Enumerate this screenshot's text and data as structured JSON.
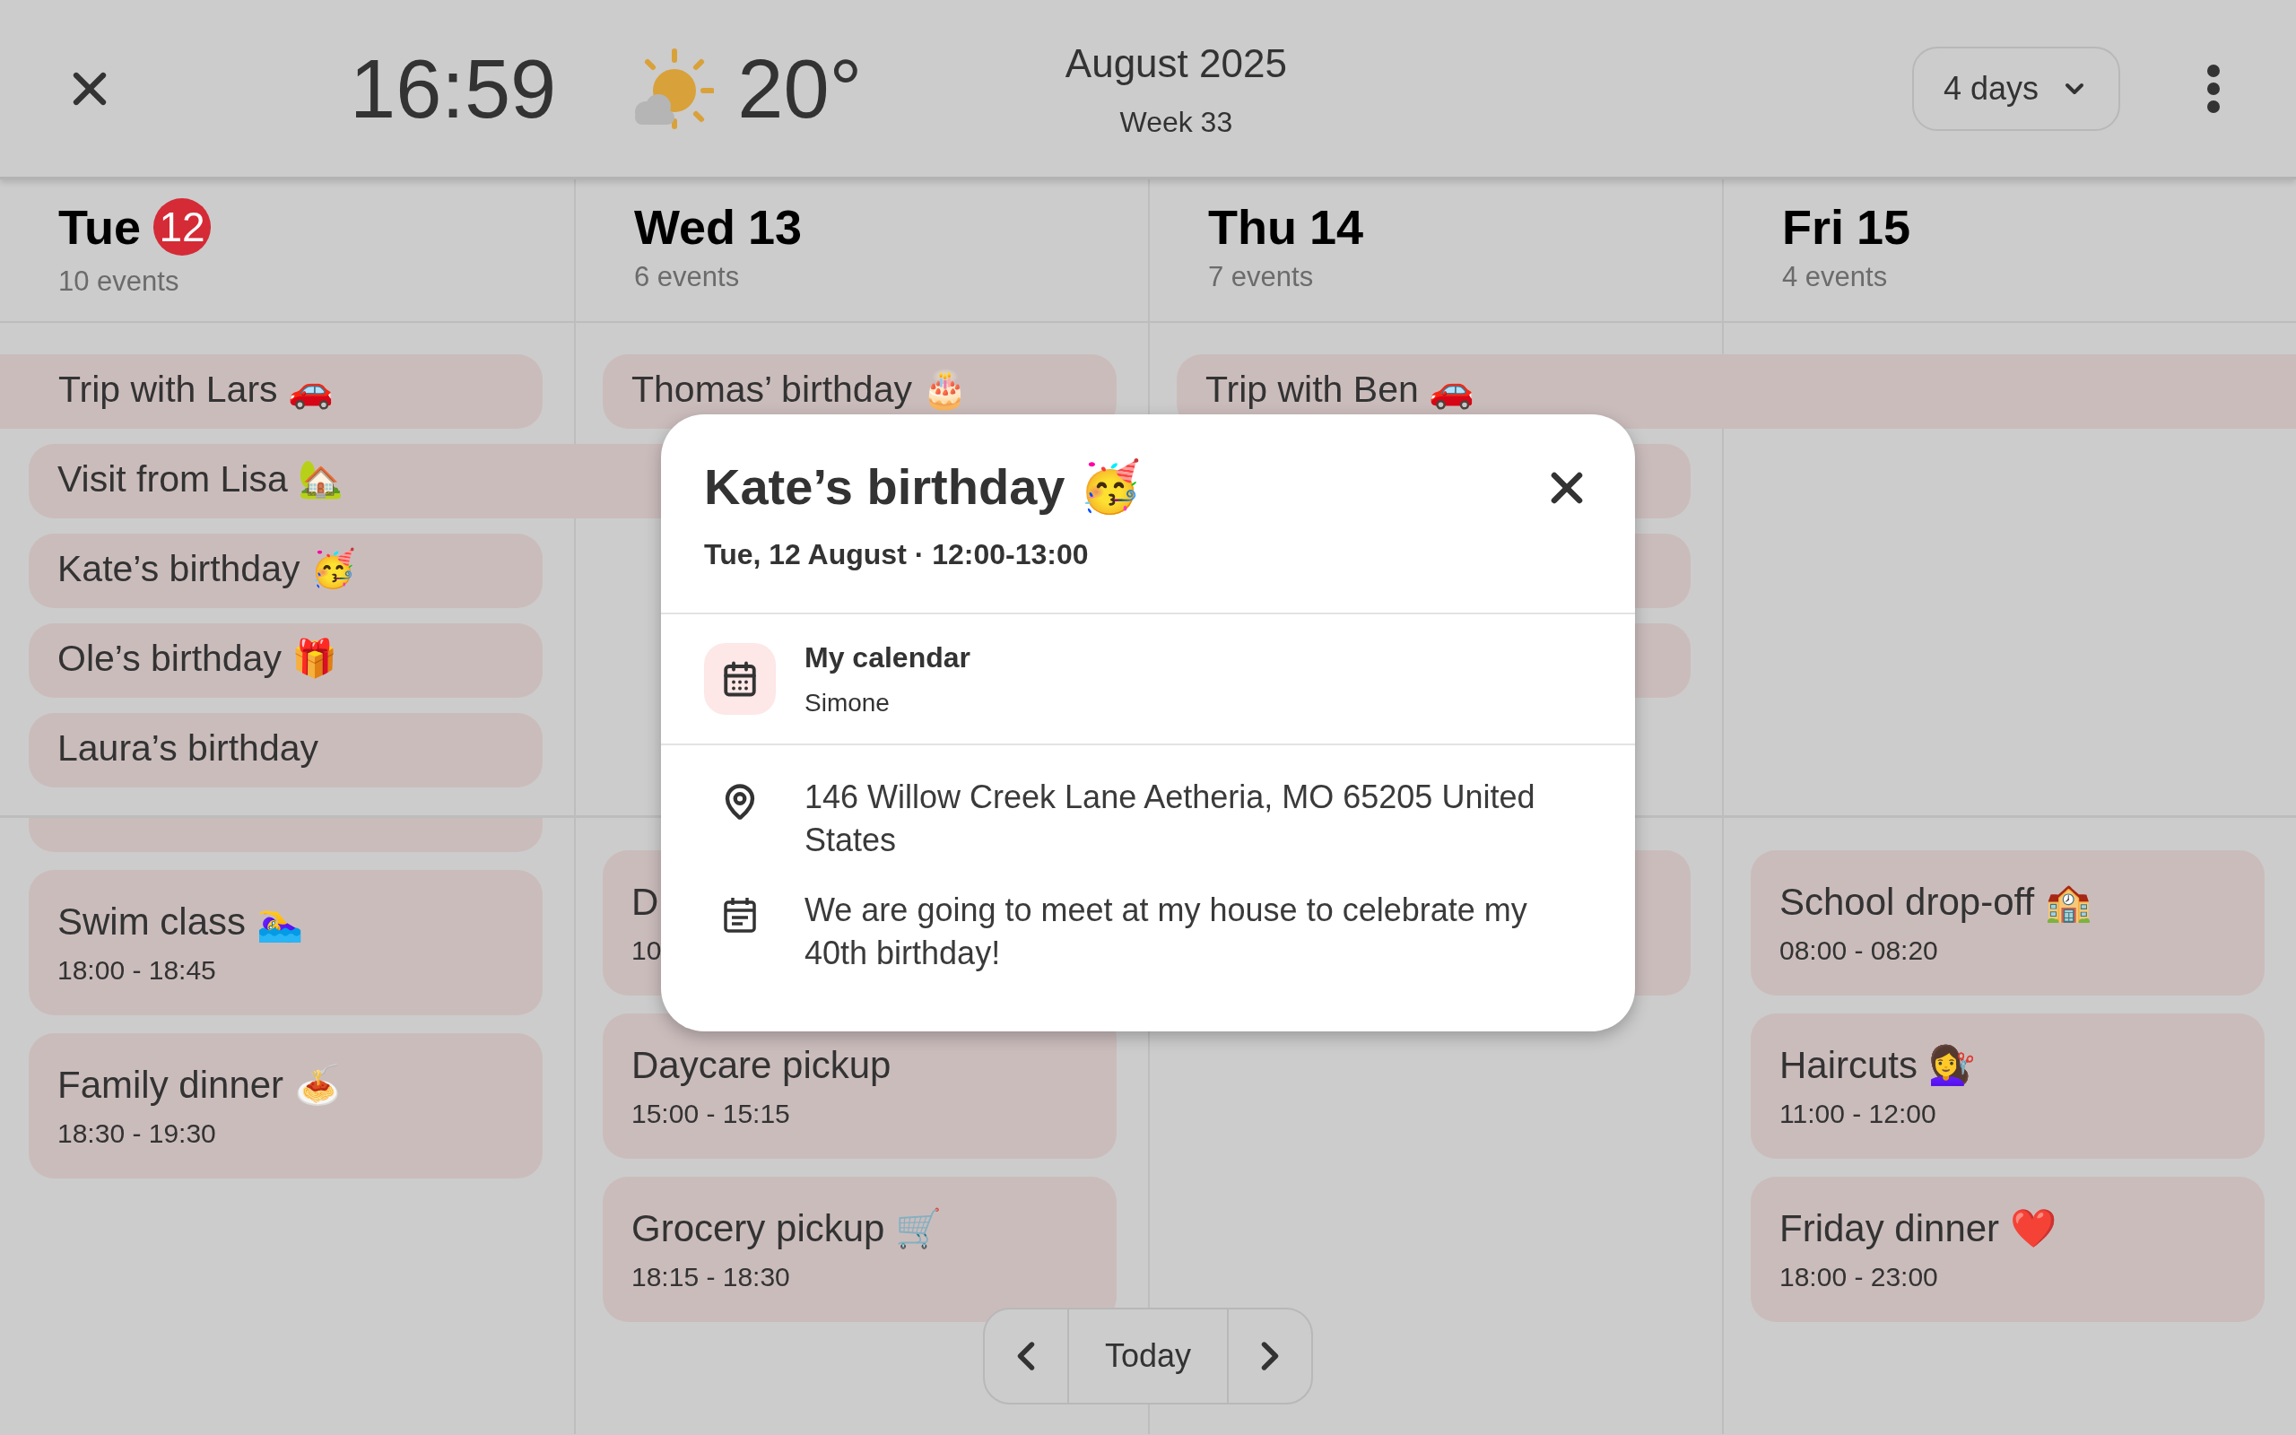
{
  "header": {
    "time": "16:59",
    "temperature": "20°",
    "month": "August 2025",
    "week": "Week 33",
    "view_selector": "4 days"
  },
  "days": [
    {
      "name": "Tue",
      "date": "12",
      "today": true,
      "count": "10 events"
    },
    {
      "name": "Wed",
      "date": "13",
      "today": false,
      "count": "6 events"
    },
    {
      "name": "Thu",
      "date": "14",
      "today": false,
      "count": "7 events"
    },
    {
      "name": "Fri",
      "date": "15",
      "today": false,
      "count": "4 events"
    }
  ],
  "all_day_rows": [
    [
      {
        "kind": "start",
        "title": "Trip with Lars 🚗",
        "continues_before": true,
        "continues_after": false
      },
      {
        "kind": "start",
        "title": "Thomas’ birthday 🎂",
        "continues_before": false,
        "continues_after": false
      },
      {
        "kind": "start",
        "title": "Trip with Ben 🚗",
        "continues_before": false,
        "continues_after": true
      },
      {
        "kind": "continued"
      }
    ],
    [
      {
        "kind": "start",
        "title": "Visit from Lisa 🏡",
        "continues_before": false,
        "continues_after": false
      },
      {
        "kind": "continued"
      },
      {
        "kind": "continued"
      },
      {
        "kind": "empty"
      }
    ],
    [
      {
        "kind": "start",
        "title": "Kate’s birthday 🥳",
        "continues_before": false,
        "continues_after": false
      },
      {
        "kind": "empty"
      },
      {
        "kind": "start",
        "continues_before": false,
        "continues_after": false
      },
      {
        "kind": "empty"
      }
    ],
    [
      {
        "kind": "start",
        "title": "Ole’s birthday 🎁",
        "continues_before": false,
        "continues_after": false
      },
      {
        "kind": "empty"
      },
      {
        "kind": "start",
        "continues_before": false,
        "continues_after": false
      },
      {
        "kind": "empty"
      }
    ],
    [
      {
        "kind": "start",
        "title": "Laura’s birthday",
        "continues_before": false,
        "continues_after": false
      },
      {
        "kind": "empty"
      },
      {
        "kind": "empty"
      },
      {
        "kind": "empty"
      }
    ]
  ],
  "timed": [
    [
      {
        "kind": "clipped"
      },
      {
        "kind": "event",
        "title": "Swim class 🏊‍♀️",
        "time": "18:00 - 18:45"
      },
      {
        "kind": "event",
        "title": "Family dinner 🍝",
        "time": "18:30 - 19:30"
      }
    ],
    [
      {
        "kind": "event",
        "title": "D",
        "time": "10"
      },
      {
        "kind": "event",
        "title": "Daycare pickup",
        "time": "15:00 - 15:15"
      },
      {
        "kind": "event",
        "title": "Grocery pickup 🛒",
        "time": "18:15 - 18:30"
      }
    ],
    [
      {
        "kind": "event"
      }
    ],
    [
      {
        "kind": "event",
        "title": "School drop-off 🏫",
        "time": "08:00 - 08:20"
      },
      {
        "kind": "event",
        "title": "Haircuts 💇‍♀️",
        "time": "11:00 - 12:00"
      },
      {
        "kind": "event",
        "title": "Friday dinner ❤️",
        "time": "18:00 - 23:00"
      }
    ]
  ],
  "popup": {
    "title": "Kate’s birthday 🥳",
    "when": "Tue, 12 August · 12:00-13:00",
    "calendar": "My calendar",
    "owner": "Simone",
    "address": "146 Willow Creek Lane Aetheria, MO 65205 United States",
    "description": "We are going to meet at my house to celebrate my 40th birthday!"
  },
  "nav": {
    "today": "Today"
  }
}
